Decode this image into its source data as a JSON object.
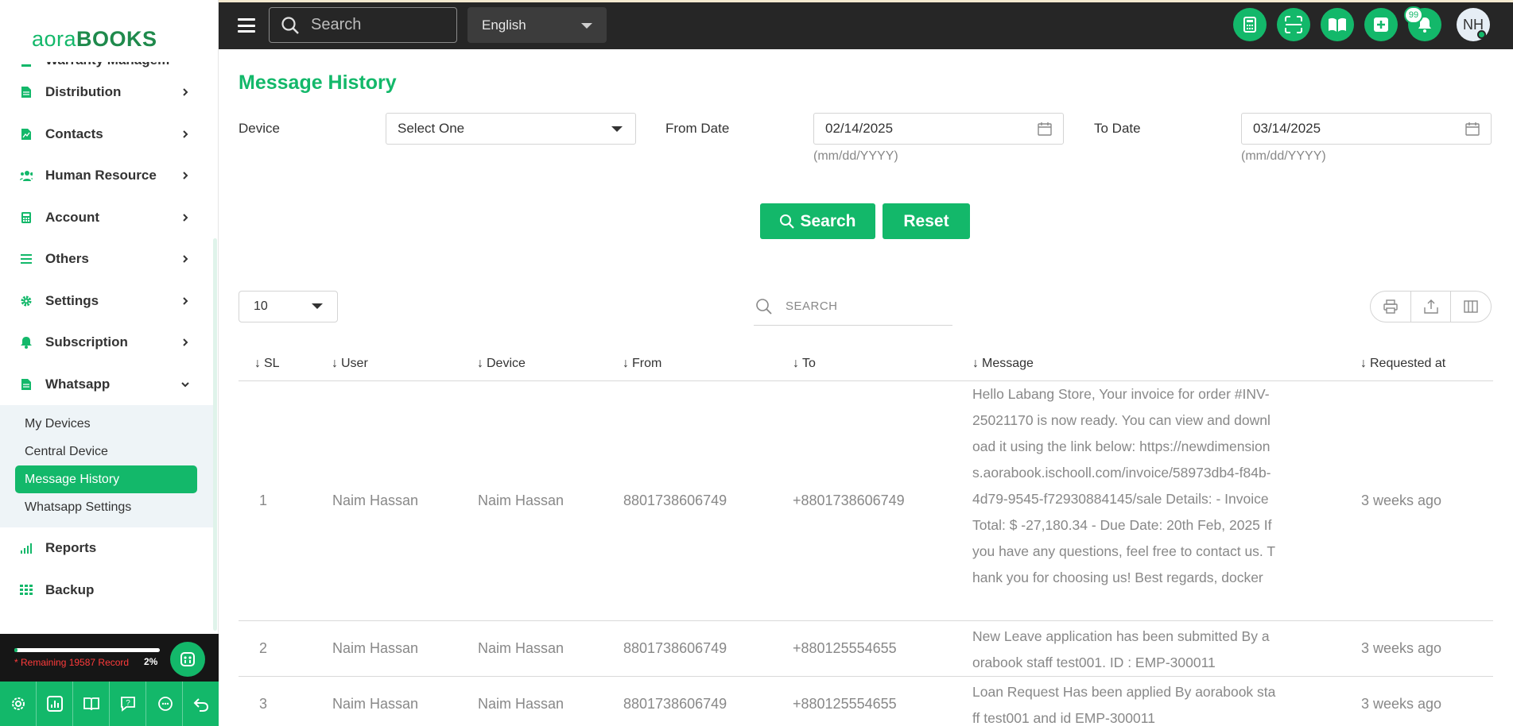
{
  "brand": {
    "logo_part1": "aora",
    "logo_part2": "BOOKS"
  },
  "topbar": {
    "search_placeholder": "Search",
    "language": "English",
    "notif_count": "99",
    "avatar_initials": "NH"
  },
  "sidebar": {
    "partial_item": "Warranty Managem",
    "items": [
      {
        "label": "Distribution",
        "icon": "document-icon"
      },
      {
        "label": "Contacts",
        "icon": "contacts-icon"
      },
      {
        "label": "Human Resource",
        "icon": "users-icon"
      },
      {
        "label": "Account",
        "icon": "calculator-icon"
      },
      {
        "label": "Others",
        "icon": "list-icon"
      },
      {
        "label": "Settings",
        "icon": "gear-icon"
      },
      {
        "label": "Subscription",
        "icon": "bell-icon"
      },
      {
        "label": "Whatsapp",
        "icon": "document-icon"
      }
    ],
    "whatsapp_sub": [
      "My Devices",
      "Central Device",
      "Message History",
      "Whatsapp Settings"
    ],
    "active_sub": "Message History",
    "after_items": [
      {
        "label": "Reports",
        "icon": "signal-icon"
      },
      {
        "label": "Backup",
        "icon": "grid-icon"
      }
    ],
    "record": {
      "text": "* Remaining 19587 Record",
      "percent": "2%",
      "progress": 0.02
    }
  },
  "page": {
    "title": "Message History",
    "filters": {
      "device_label": "Device",
      "device_value": "Select One",
      "from_label": "From Date",
      "from_value": "02/14/2025",
      "from_hint": "(mm/dd/YYYY)",
      "to_label": "To Date",
      "to_value": "03/14/2025",
      "to_hint": "(mm/dd/YYYY)"
    },
    "search_button": "Search",
    "reset_button": "Reset",
    "per_page": "10",
    "table_search_placeholder": "SEARCH",
    "columns": [
      "SL",
      "User",
      "Device",
      "From",
      "To",
      "Message",
      "Requested at"
    ],
    "rows": [
      {
        "sl": "1",
        "user": "Naim Hassan",
        "device": "Naim Hassan",
        "from": "8801738606749",
        "to": "+8801738606749",
        "message": "Hello Labang Store, Your invoice for order #INV-25021170 is now ready. You can view and download it using the link below: https://newdimensions.aorabook.ischooll.com/invoice/58973db4-f84b-4d79-9545-f72930884145/sale Details: - Invoice Total: $ -27,180.34 - Due Date: 20th Feb, 2025 If you have any questions, feel free to contact us. Thank you for choosing us! Best regards, docker",
        "requested": "3 weeks ago"
      },
      {
        "sl": "2",
        "user": "Naim Hassan",
        "device": "Naim Hassan",
        "from": "8801738606749",
        "to": "+880125554655",
        "message": "New Leave application has been submitted By aorabook staff test001. ID : EMP-300011",
        "requested": "3 weeks ago"
      },
      {
        "sl": "3",
        "user": "Naim Hassan",
        "device": "Naim Hassan",
        "from": "8801738606749",
        "to": "+880125554655",
        "message": "Loan Request Has been applied By aorabook staff test001 and id EMP-300011",
        "requested": "3 weeks ago"
      }
    ]
  },
  "colors": {
    "accent": "#13b86a",
    "topbar": "#262626"
  }
}
